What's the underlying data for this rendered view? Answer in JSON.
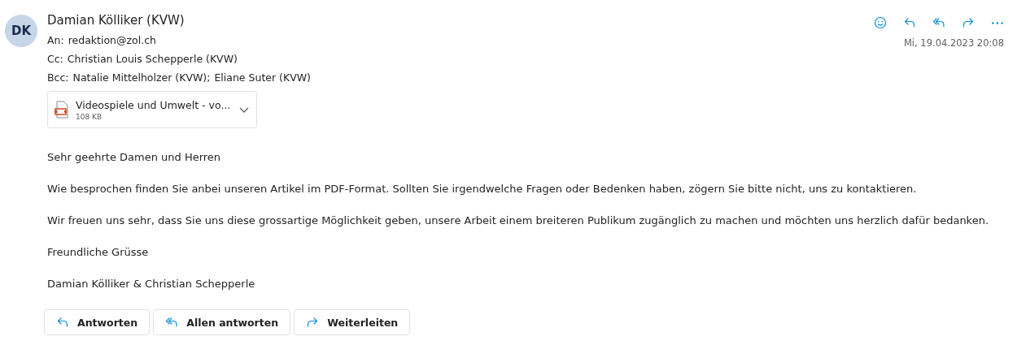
{
  "sender": {
    "initials": "DK",
    "name": "Damian Kölliker (KVW)"
  },
  "recipients": [
    {
      "label": "An:",
      "names": [
        "redaktion@zol.ch"
      ]
    },
    {
      "label": "Cc:",
      "names": [
        "Christian Louis Schepperle (KVW)"
      ]
    },
    {
      "label": "Bcc:",
      "names": [
        "Natalie Mittelholzer (KVW);",
        "Eliane Suter (KVW)"
      ]
    }
  ],
  "toolbar": [
    {
      "kind": "emoji"
    },
    {
      "kind": "reply"
    },
    {
      "kind": "reply-all"
    },
    {
      "kind": "forward"
    },
    {
      "kind": "more"
    }
  ],
  "date": "Mi, 19.04.2023 20:08",
  "attachment": {
    "name": "Videospiele und Umwelt - vo...",
    "size": "108 KB"
  },
  "body": [
    "Sehr geehrte Damen und Herren",
    "Wie besprochen finden Sie anbei unseren Artikel im PDF-Format. Sollten Sie irgendwelche Fragen oder Bedenken haben, zögern Sie bitte nicht, uns zu kontaktieren.",
    "Wir freuen uns sehr, dass Sie uns diese grossartige Möglichkeit geben, unsere Arbeit einem breiteren Publikum zugänglich zu machen und möchten uns herzlich dafür bedanken.",
    "Freundliche Grüsse",
    "Damian Kölliker & Christian Schepperle"
  ],
  "actions": [
    {
      "kind": "reply",
      "label": "Antworten"
    },
    {
      "kind": "reply-all",
      "label": "Allen antworten"
    },
    {
      "kind": "forward",
      "label": "Weiterleiten"
    }
  ]
}
